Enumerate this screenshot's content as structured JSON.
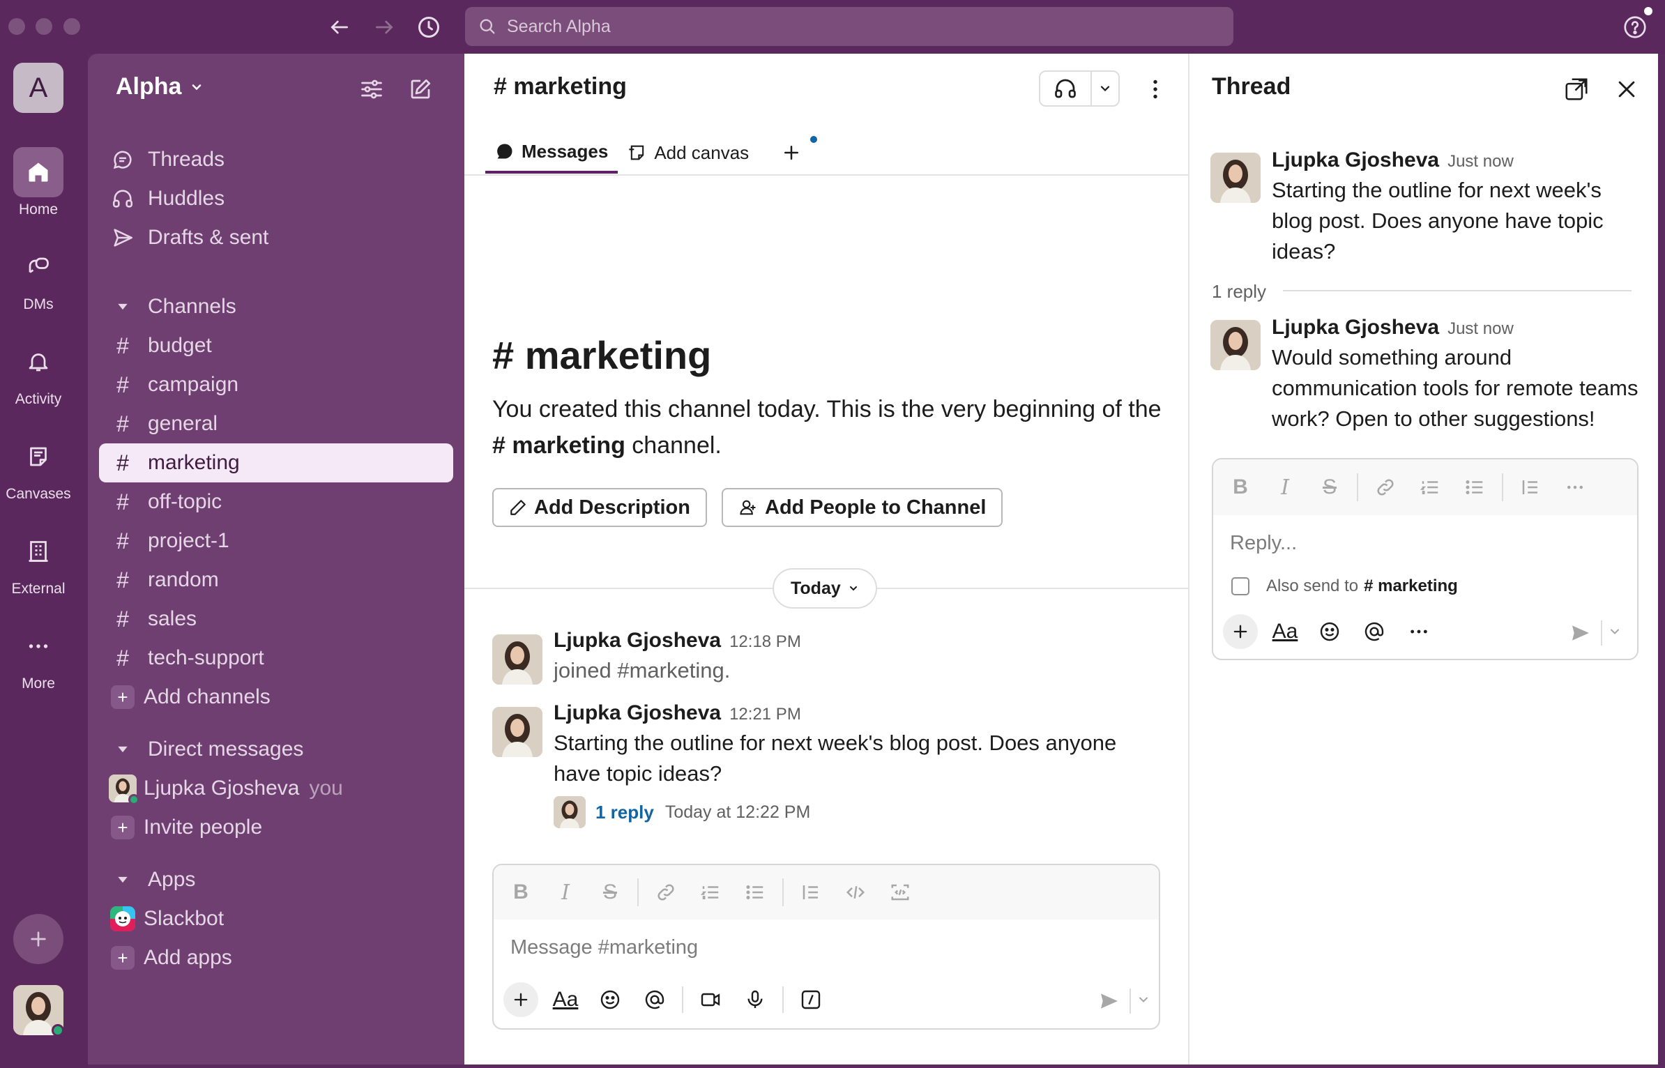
{
  "app": {
    "search_placeholder": "Search Alpha"
  },
  "rail": {
    "workspace_initial": "A",
    "items": [
      {
        "label": "Home",
        "icon": "home-icon",
        "active": true
      },
      {
        "label": "DMs",
        "icon": "dms-icon"
      },
      {
        "label": "Activity",
        "icon": "bell-icon"
      },
      {
        "label": "Canvases",
        "icon": "canvas-icon"
      },
      {
        "label": "External",
        "icon": "building-icon"
      },
      {
        "label": "More",
        "icon": "ellipsis-icon"
      }
    ]
  },
  "sidebar": {
    "workspace_name": "Alpha",
    "top_items": [
      {
        "label": "Threads",
        "icon": "threads-icon"
      },
      {
        "label": "Huddles",
        "icon": "headphones-icon"
      },
      {
        "label": "Drafts & sent",
        "icon": "send-icon"
      }
    ],
    "channels_header": "Channels",
    "channels": [
      {
        "name": "budget"
      },
      {
        "name": "campaign"
      },
      {
        "name": "general"
      },
      {
        "name": "marketing",
        "active": true
      },
      {
        "name": "off-topic"
      },
      {
        "name": "project-1"
      },
      {
        "name": "random"
      },
      {
        "name": "sales"
      },
      {
        "name": "tech-support"
      }
    ],
    "add_channels": "Add channels",
    "dm_header": "Direct messages",
    "dm_user": "Ljupka Gjosheva",
    "dm_you": "you",
    "invite_people": "Invite people",
    "apps_header": "Apps",
    "app_slackbot": "Slackbot",
    "add_apps": "Add apps"
  },
  "channel": {
    "hash": "#",
    "name": "marketing",
    "tabs": [
      {
        "label": "Messages",
        "icon": "message-bubble-icon",
        "active": true
      },
      {
        "label": "Add canvas",
        "icon": "canvas-add-icon"
      }
    ],
    "intro_title": "marketing",
    "intro_text_1": "You created this channel today. This is the very beginning of the ",
    "intro_channel": "# marketing",
    "intro_text_2": " channel.",
    "add_description": "Add Description",
    "add_people": "Add People to Channel",
    "day_divider": "Today",
    "messages": [
      {
        "author": "Ljupka Gjosheva",
        "time": "12:18 PM",
        "text": "joined #marketing."
      },
      {
        "author": "Ljupka Gjosheva",
        "time": "12:21 PM",
        "text": "Starting the outline for next week's blog post. Does anyone have topic ideas?",
        "reply_count": "1 reply",
        "reply_time": "Today at 12:22 PM"
      }
    ],
    "composer_placeholder": "Message #marketing"
  },
  "thread": {
    "title": "Thread",
    "parent": {
      "author": "Ljupka Gjosheva",
      "time": "Just now",
      "text": "Starting the outline for next week's blog post. Does anyone have topic ideas?"
    },
    "replies_label": "1 reply",
    "reply": {
      "author": "Ljupka Gjosheva",
      "time": "Just now",
      "text": "Would something around communication tools for remote teams work? Open to other suggestions!"
    },
    "composer_placeholder": "Reply...",
    "also_send": "Also send to",
    "also_send_channel": "# marketing"
  },
  "colors": {
    "aubergine": "#5a285c",
    "sidebar": "#6f3f72",
    "active_item": "#f5e9f7",
    "link": "#1264a3",
    "online": "#2bac76"
  }
}
